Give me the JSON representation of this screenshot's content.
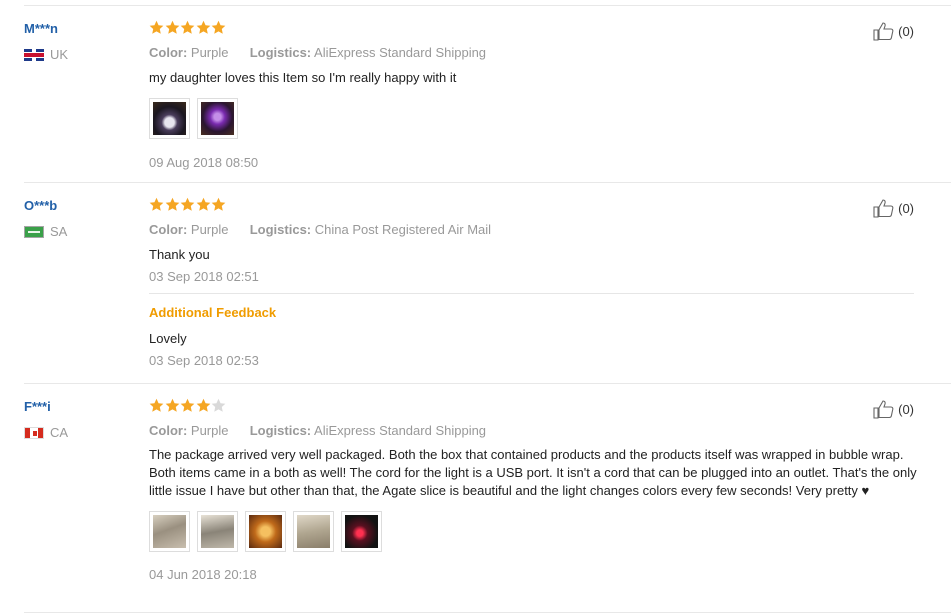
{
  "reviews": [
    {
      "user": "M***n",
      "country": "UK",
      "flag_icon": "flag-uk-icon",
      "stars": 5,
      "color_label": "Color:",
      "color_value": "Purple",
      "logistics_label": "Logistics:",
      "logistics_value": "AliExpress Standard Shipping",
      "text": "my daughter loves this Item so I'm really happy with it",
      "images": 2,
      "date": "09 Aug 2018 08:50",
      "helpful_count": "(0)"
    },
    {
      "user": "O***b",
      "country": "SA",
      "flag_icon": "flag-sa-icon",
      "stars": 5,
      "color_label": "Color:",
      "color_value": "Purple",
      "logistics_label": "Logistics:",
      "logistics_value": "China Post Registered Air Mail",
      "text": "Thank you",
      "date": "03 Sep 2018 02:51",
      "additional_feedback": {
        "title": "Additional Feedback",
        "text": "Lovely",
        "date": "03 Sep 2018 02:53"
      },
      "helpful_count": "(0)"
    },
    {
      "user": "F***i",
      "country": "CA",
      "flag_icon": "flag-ca-icon",
      "stars": 4,
      "color_label": "Color:",
      "color_value": "Purple",
      "logistics_label": "Logistics:",
      "logistics_value": "AliExpress Standard Shipping",
      "text": "The package arrived very well packaged. Both the box that contained products and the products itself was wrapped in bubble wrap. Both items came in a both as well! The cord for the light is a USB port. It isn't a cord that can be plugged into an outlet. That's the only little issue I have but other than that, the Agate slice is beautiful and the light changes colors every few seconds! Very pretty",
      "heart": "♥",
      "images": 5,
      "date": "04 Jun 2018 20:18",
      "helpful_count": "(0)"
    }
  ],
  "colors": {
    "star_filled": "#f5a623",
    "star_empty": "#d9d9d9",
    "username": "#2260a8",
    "additional_title": "#f09c00"
  }
}
